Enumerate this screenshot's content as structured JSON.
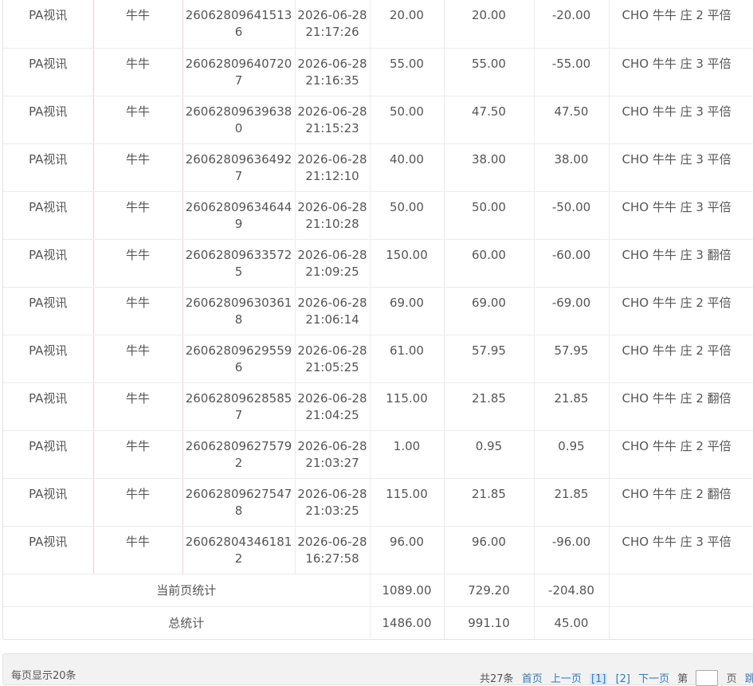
{
  "rows": [
    {
      "platform": "PA视讯",
      "game": "牛牛",
      "order_no": "260628096415136",
      "time": "2026-06-28 21:17:26",
      "bet": "20.00",
      "valid_bet": "20.00",
      "win_loss": "-20.00",
      "detail": "CHO 牛牛 庄 2 平倍"
    },
    {
      "platform": "PA视讯",
      "game": "牛牛",
      "order_no": "260628096407207",
      "time": "2026-06-28 21:16:35",
      "bet": "55.00",
      "valid_bet": "55.00",
      "win_loss": "-55.00",
      "detail": "CHO 牛牛 庄 3 平倍"
    },
    {
      "platform": "PA视讯",
      "game": "牛牛",
      "order_no": "260628096396380",
      "time": "2026-06-28 21:15:23",
      "bet": "50.00",
      "valid_bet": "47.50",
      "win_loss": "47.50",
      "detail": "CHO 牛牛 庄 3 平倍"
    },
    {
      "platform": "PA视讯",
      "game": "牛牛",
      "order_no": "260628096364927",
      "time": "2026-06-28 21:12:10",
      "bet": "40.00",
      "valid_bet": "38.00",
      "win_loss": "38.00",
      "detail": "CHO 牛牛 庄 3 平倍"
    },
    {
      "platform": "PA视讯",
      "game": "牛牛",
      "order_no": "260628096346449",
      "time": "2026-06-28 21:10:28",
      "bet": "50.00",
      "valid_bet": "50.00",
      "win_loss": "-50.00",
      "detail": "CHO 牛牛 庄 3 平倍"
    },
    {
      "platform": "PA视讯",
      "game": "牛牛",
      "order_no": "260628096335725",
      "time": "2026-06-28 21:09:25",
      "bet": "150.00",
      "valid_bet": "60.00",
      "win_loss": "-60.00",
      "detail": "CHO 牛牛 庄 3 翻倍"
    },
    {
      "platform": "PA视讯",
      "game": "牛牛",
      "order_no": "260628096303618",
      "time": "2026-06-28 21:06:14",
      "bet": "69.00",
      "valid_bet": "69.00",
      "win_loss": "-69.00",
      "detail": "CHO 牛牛 庄 2 平倍"
    },
    {
      "platform": "PA视讯",
      "game": "牛牛",
      "order_no": "260628096295596",
      "time": "2026-06-28 21:05:25",
      "bet": "61.00",
      "valid_bet": "57.95",
      "win_loss": "57.95",
      "detail": "CHO 牛牛 庄 2 平倍"
    },
    {
      "platform": "PA视讯",
      "game": "牛牛",
      "order_no": "260628096285857",
      "time": "2026-06-28 21:04:25",
      "bet": "115.00",
      "valid_bet": "21.85",
      "win_loss": "21.85",
      "detail": "CHO 牛牛 庄 2 翻倍"
    },
    {
      "platform": "PA视讯",
      "game": "牛牛",
      "order_no": "260628096275792",
      "time": "2026-06-28 21:03:27",
      "bet": "1.00",
      "valid_bet": "0.95",
      "win_loss": "0.95",
      "detail": "CHO 牛牛 庄 2 平倍"
    },
    {
      "platform": "PA视讯",
      "game": "牛牛",
      "order_no": "260628096275478",
      "time": "2026-06-28 21:03:25",
      "bet": "115.00",
      "valid_bet": "21.85",
      "win_loss": "21.85",
      "detail": "CHO 牛牛 庄 2 翻倍"
    },
    {
      "platform": "PA视讯",
      "game": "牛牛",
      "order_no": "260628043461812",
      "time": "2026-06-28 16:27:58",
      "bet": "96.00",
      "valid_bet": "96.00",
      "win_loss": "-96.00",
      "detail": "CHO 牛牛 庄 3 平倍"
    }
  ],
  "summary": {
    "page_label": "当前页统计",
    "page_bet": "1089.00",
    "page_valid": "729.20",
    "page_winloss": "-204.80",
    "total_label": "总统计",
    "total_bet": "1486.00",
    "total_valid": "991.10",
    "total_winloss": "45.00"
  },
  "pagination": {
    "per_page": "每页显示20条",
    "total": "共27条",
    "first": "首页",
    "prev": "上一页",
    "page1": "[1]",
    "page2": "[2]",
    "next": "下一页",
    "goto_prefix": "第",
    "goto_suffix": "页",
    "jump": "跳转"
  }
}
